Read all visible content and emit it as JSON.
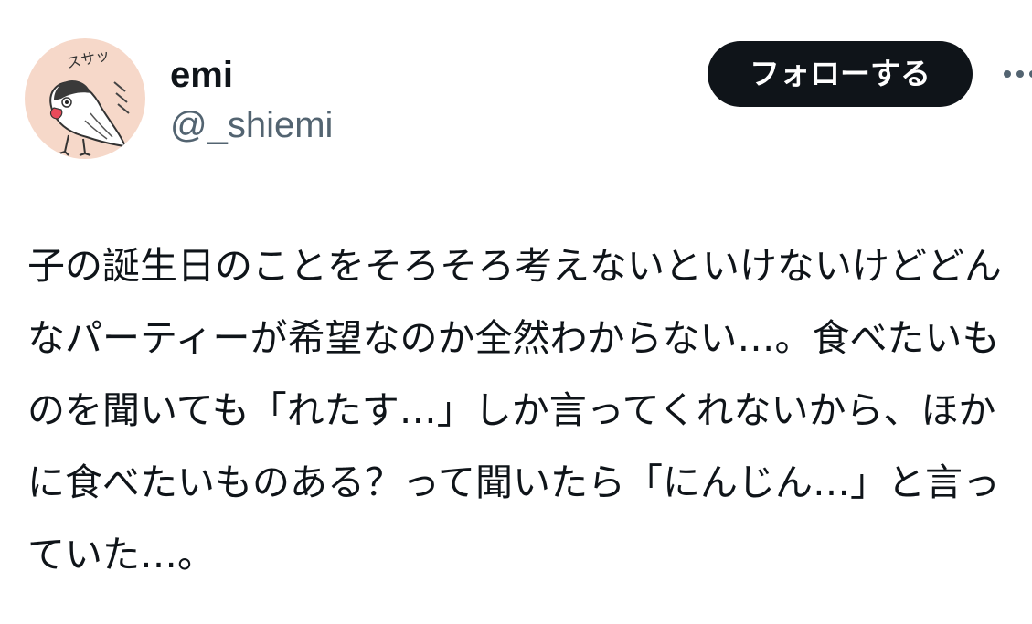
{
  "author": {
    "display_name": "emi",
    "handle": "@_shiemi",
    "avatar": {
      "icon": "java-sparrow-sketch-avatar",
      "caption": "スサッ",
      "background": "#f6d8c9"
    }
  },
  "actions": {
    "follow_label": "フォローする",
    "more_icon": "more-dots-icon"
  },
  "tweet": {
    "text": "子の誕生日のことをそろそろ考えないといけないけどどんなパーティーが希望なのか全然わからない…。食べたいものを聞いても「れたす…」しか言ってくれないから、ほかに食べたいものある？って聞いたら「にんじん…」と言っていた…。"
  },
  "colors": {
    "text_primary": "#0f1419",
    "text_secondary": "#536471",
    "button_bg": "#0f1419",
    "button_text": "#ffffff"
  }
}
